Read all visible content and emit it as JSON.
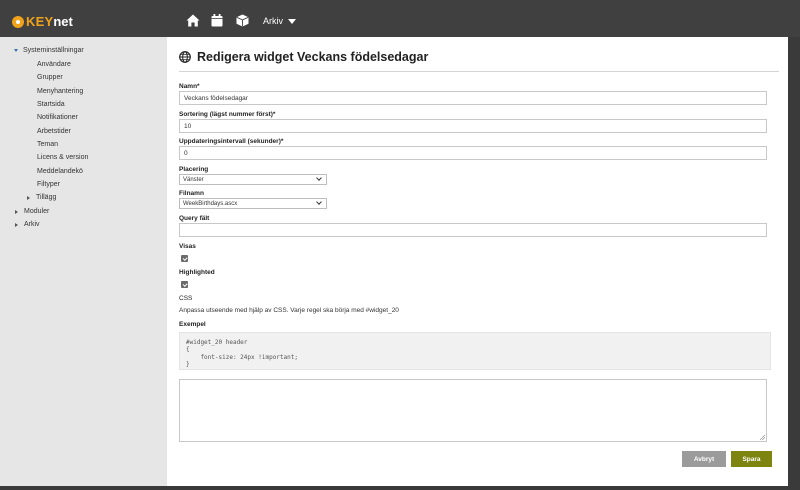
{
  "app": {
    "logo_key": "KEY",
    "logo_net": "net"
  },
  "topnav": {
    "icons": [
      "home-icon",
      "calendar-icon",
      "cube-icon"
    ],
    "archive_label": "Arkiv"
  },
  "sidebar": {
    "root": {
      "label": "Systeminställningar",
      "children": [
        "Användare",
        "Grupper",
        "Menyhantering",
        "Startsida",
        "Notifikationer",
        "Arbetstider",
        "Teman",
        "Licens & version",
        "Meddelandekö",
        "Filtyper"
      ],
      "addons": "Tillägg"
    },
    "modules": "Moduler",
    "archive": "Arkiv"
  },
  "form": {
    "title": "Redigera widget Veckans födelsedagar",
    "name_label": "Namn*",
    "name_value": "Veckans födelsedagar",
    "sort_label": "Sortering (lägst nummer först)*",
    "sort_value": "10",
    "interval_label": "Uppdateringsintervall (sekunder)*",
    "interval_value": "0",
    "placement_label": "Placering",
    "placement_value": "Vänster",
    "filename_label": "Filnamn",
    "filename_value": "WeekBirthdays.ascx",
    "query_label": "Query fält",
    "query_value": "",
    "visible_label": "Visas",
    "visible_checked": true,
    "highlighted_label": "Highlighted",
    "highlighted_checked": true,
    "css_label": "CSS",
    "css_help": "Anpassa utseende med hjälp av CSS. Varje regel ska börja med #widget_20",
    "example_label": "Exempel",
    "example_code": "#widget_20 header\n{\n    font-size: 24px !important;\n}",
    "css_value": "",
    "cancel_label": "Avbryt",
    "save_label": "Spara"
  },
  "colors": {
    "topbar": "#404040",
    "logo_accent": "#f0a21a",
    "save_button": "#7d8410",
    "cancel_button": "#9b9b9b"
  }
}
